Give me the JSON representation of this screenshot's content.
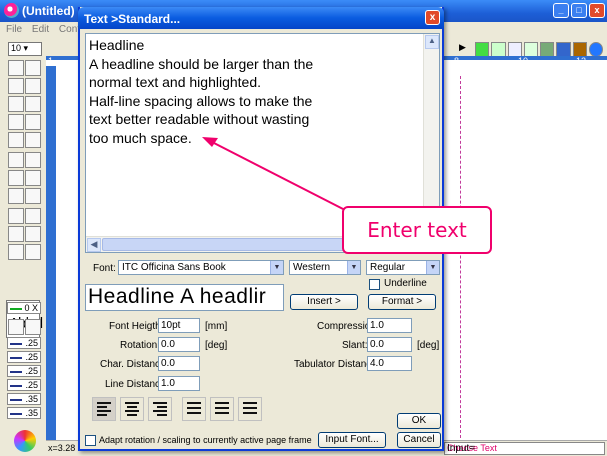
{
  "app": {
    "title": "(Untitled)",
    "menu": [
      "File",
      "Edit",
      "Confi"
    ],
    "zoom": "10"
  },
  "dialog": {
    "title": "Text >Standard...",
    "text": "Headline\nA headline should be larger than the\nnormal text and highlighted.\nHalf-line spacing allows to make the\ntext better readable without wasting\ntoo much space.",
    "font_label": "Font:",
    "font_value": "ITC Officina Sans Book",
    "script_value": "Western",
    "style_value": "Regular",
    "underline_label": "Underline",
    "preview_text": "Headline   A headlir",
    "insert_label": "Insert >",
    "format_label": "Format >",
    "font_height_label": "Font Heigth:",
    "font_height_value": "10pt",
    "font_height_unit": "[mm]",
    "rotation_label": "Rotation:",
    "rotation_value": "0.0",
    "rotation_unit": "[deg]",
    "char_distance_label": "Char. Distance:",
    "char_distance_value": "0.0",
    "line_distance_label": "Line Distance:",
    "line_distance_value": "1.0",
    "compression_label": "Compression:",
    "compression_value": "1.0",
    "slant_label": "Slant:",
    "slant_value": "0.0",
    "slant_unit": "[deg]",
    "tab_distance_label": "Tabulator Distance:",
    "tab_distance_value": "4.0",
    "ok_label": "OK",
    "adapt_label": "Adapt rotation / scaling to currently active page frame",
    "input_font_label": "Input Font...",
    "cancel_label": "Cancel"
  },
  "callout": {
    "text": "Enter text",
    "color": "#f0006c"
  },
  "status": {
    "coord": "x=3.28",
    "input_label": "Input=",
    "input_value": "Choose Text"
  },
  "line_widths": [
    "0 X",
    ".25",
    ".25",
    ".25",
    ".25",
    ".35",
    ".35"
  ]
}
